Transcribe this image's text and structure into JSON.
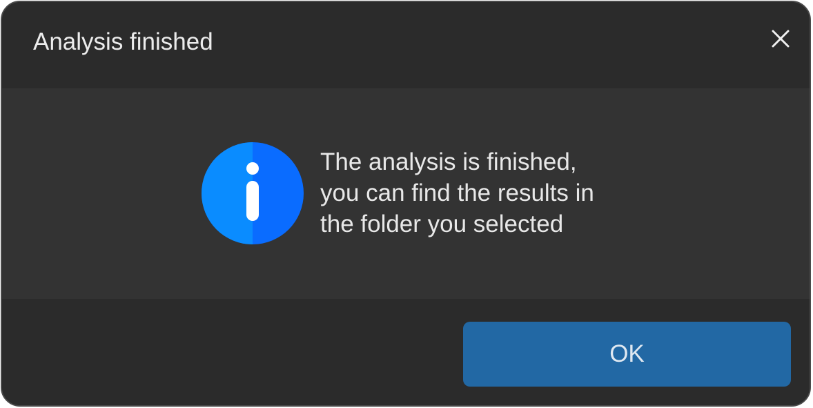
{
  "dialog": {
    "title": "Analysis finished",
    "message_lines": [
      "The analysis is finished,",
      "you can find the results in",
      "the folder you selected"
    ],
    "icon": "info-icon",
    "ok_label": "OK",
    "close_icon": "close-icon"
  },
  "colors": {
    "background": "#2b2b2b",
    "content_background": "#333333",
    "info_icon": "#0a84ff",
    "ok_button": "#2268a4"
  }
}
